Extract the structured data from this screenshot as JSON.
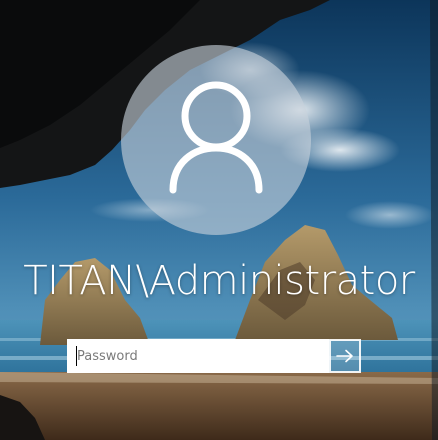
{
  "login": {
    "username": "TITAN\\Administrator",
    "password_placeholder": "Password",
    "password_value": ""
  },
  "icons": {
    "avatar": "user-silhouette-icon",
    "submit": "arrow-right-icon"
  },
  "colors": {
    "sky_top": "#0f3d66",
    "sky_mid": "#2f6f9f",
    "sea": "#3a86ad",
    "sand": "#6a4a2c",
    "avatar_fill": "#c8d2dc"
  }
}
